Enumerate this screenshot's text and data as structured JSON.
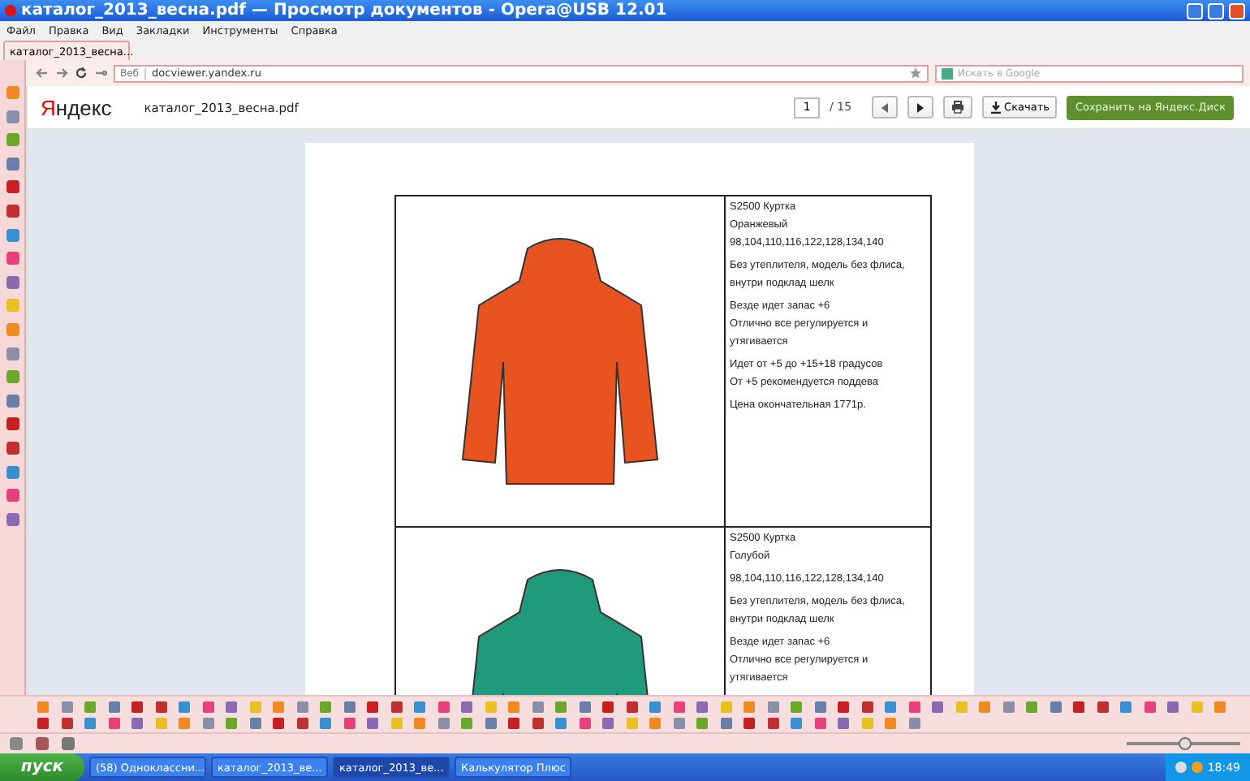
{
  "window": {
    "title": "каталог_2013_весна.pdf — Просмотр документов - Opera@USB 12.01"
  },
  "menu": [
    "Файл",
    "Правка",
    "Вид",
    "Закладки",
    "Инструменты",
    "Справка"
  ],
  "tabs": [
    {
      "label": "каталог_2013_весна...",
      "selected": true
    }
  ],
  "address": {
    "badge": "Веб",
    "url": "docviewer.yandex.ru",
    "search_placeholder": "Искать в Google"
  },
  "viewer": {
    "logo": "Яндекс",
    "filename": "каталог_2013_весна.pdf",
    "page": "1",
    "total": "/ 15",
    "download": "Скачать",
    "save": "Сохранить на Яндекс.Диск"
  },
  "rows": [
    {
      "color": "#e8531f",
      "paragraphs": [
        [
          "S2500 Куртка",
          "Оранжевый",
          "98,104,110,116,122,128,134,140"
        ],
        [
          "Без утеплителя, модель без флиса,",
          "внутри подклад шелк"
        ],
        [
          "Везде идет запас +6",
          "Отлично все регулируется и",
          "утягивается"
        ],
        [
          "Идет от +5 до +15+18 градусов",
          "От +5  рекомендуется поддева"
        ],
        [
          "Цена окончательная 1771р."
        ]
      ]
    },
    {
      "color": "#1f9a7a",
      "paragraphs": [
        [
          "S2500 Куртка",
          "Голубой"
        ],
        [
          "98,104,110,116,122,128,134,140"
        ],
        [
          "Без утеплителя, модель без флиса,",
          "внутри подклад шелк"
        ],
        [
          "Везде идет запас +6",
          "Отлично все регулируется и",
          "утягивается"
        ]
      ]
    }
  ],
  "zoom": {
    "level": 0.5
  },
  "taskbar": {
    "start": "пуск",
    "items": [
      {
        "label": "(58) Одноклассни...",
        "selected": false
      },
      {
        "label": "каталог_2013_ве...",
        "selected": false
      },
      {
        "label": "каталог_2013_ве...",
        "selected": true
      },
      {
        "label": "Калькулятор Плюс",
        "selected": false
      }
    ],
    "clock": "18:49"
  }
}
